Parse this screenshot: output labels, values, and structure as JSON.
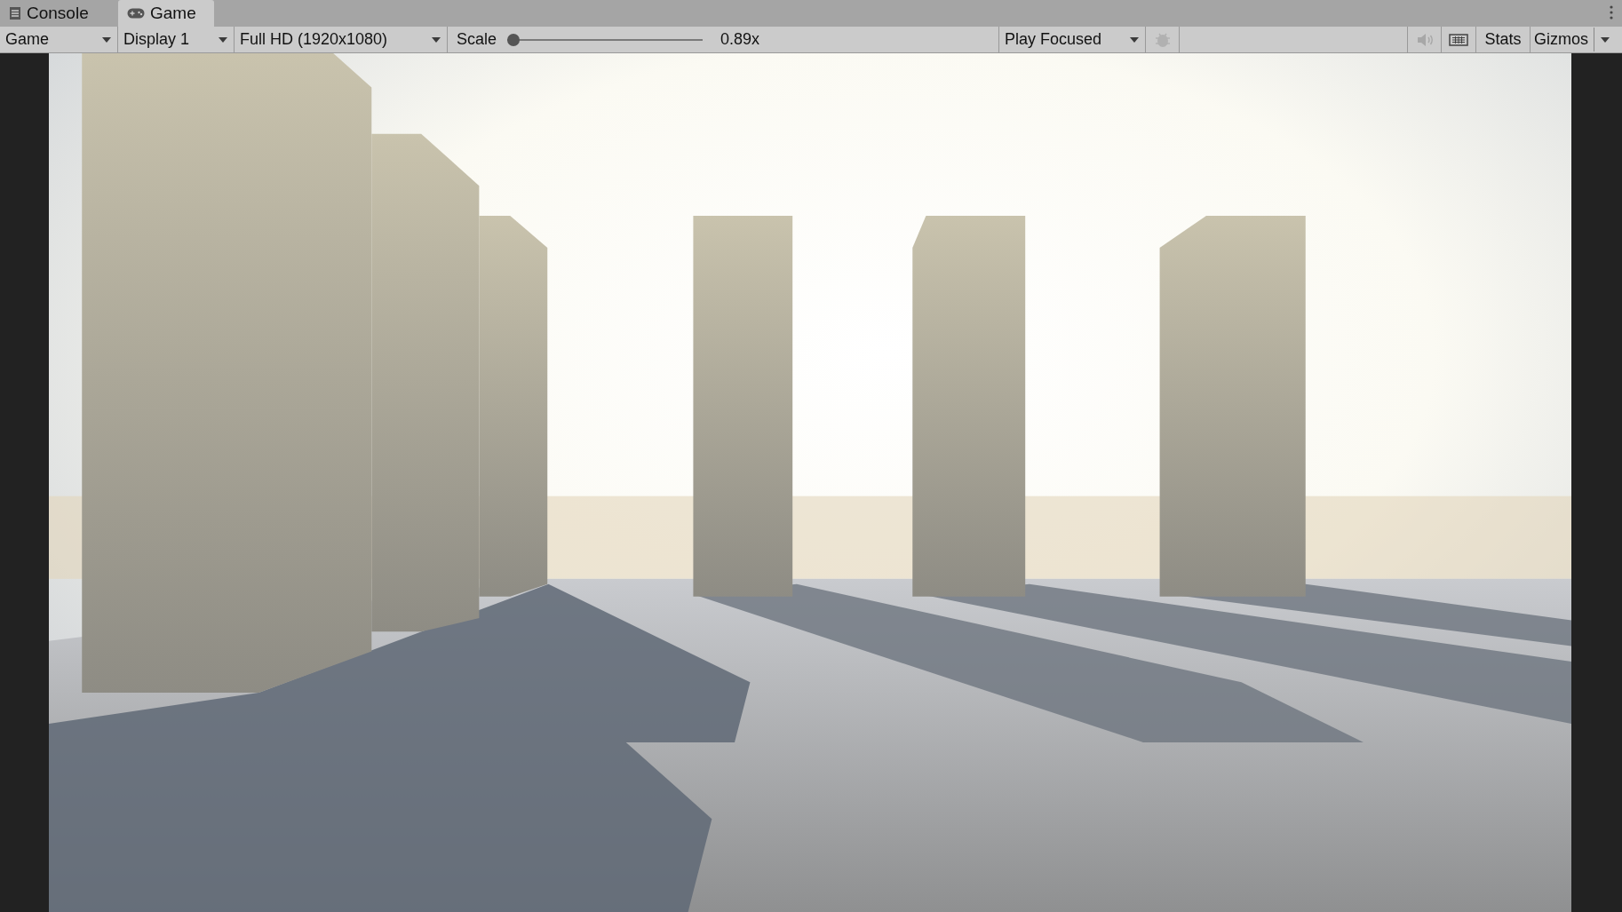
{
  "tabs": [
    {
      "kind": "console",
      "label": "Console",
      "selected": false
    },
    {
      "kind": "game",
      "label": "Game",
      "selected": true
    }
  ],
  "toolbar": {
    "view_dropdown": "Game",
    "display_dropdown": "Display 1",
    "resolution_dropdown": "Full HD (1920x1080)",
    "scale": {
      "label": "Scale",
      "level": 0,
      "reading": "0.89x"
    },
    "play_mode_dropdown": "Play Focused",
    "debug_button": {
      "disabled": true
    },
    "mute_audio": {
      "on": false
    },
    "stats": {
      "label": "Stats",
      "on": false
    },
    "gizmos": {
      "label": "Gizmos",
      "on": false
    }
  }
}
